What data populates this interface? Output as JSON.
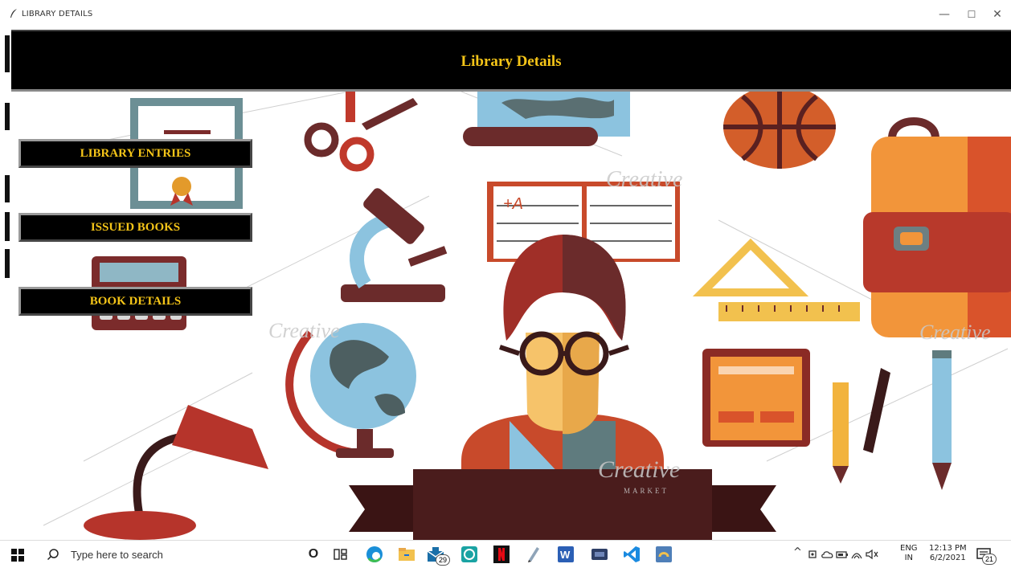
{
  "window": {
    "title": "LIBRARY DETAILS",
    "minimize_glyph": "—",
    "maximize_glyph": "☐",
    "close_glyph": "✕"
  },
  "header": {
    "title": "Library Details"
  },
  "menu": {
    "items": [
      {
        "label": "LIBRARY ENTRIES"
      },
      {
        "label": "ISSUED BOOKS"
      },
      {
        "label": "BOOK DETAILS"
      }
    ]
  },
  "illustration": {
    "watermark": "Creative",
    "watermark_sub": "MARKET"
  },
  "taskbar": {
    "search_placeholder": "Type here to search",
    "cortana_glyph": "O",
    "mail_badge": "29",
    "tray_glyphs": "^",
    "language_line1": "ENG",
    "language_line2": "IN",
    "time": "12:13 PM",
    "date": "6/2/2021",
    "notification_count": "21"
  },
  "colors": {
    "header_bg": "#000000",
    "header_text": "#f5c518",
    "button_text": "#f5c518"
  }
}
